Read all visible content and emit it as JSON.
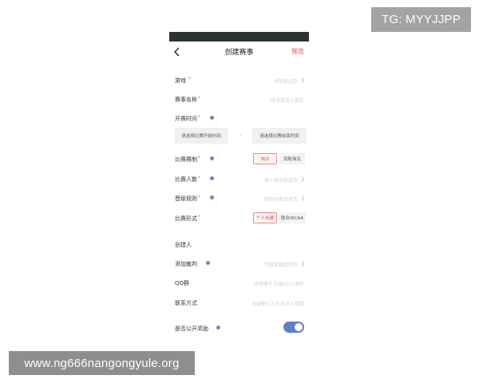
{
  "watermarks": {
    "top": "TG: MYYJJPP",
    "bottom": "www.ng666nangongyule.org"
  },
  "nav": {
    "title": "创建赛事",
    "preview_label": "预览"
  },
  "form": {
    "game": {
      "label": "游戏",
      "required": "*",
      "placeholder": "请选择游戏"
    },
    "name": {
      "label": "赛事名称",
      "required": "*",
      "placeholder": "请输入赛事名称"
    },
    "time": {
      "label": "开赛时间",
      "required": "*",
      "start_placeholder": "请选择比赛开始时间",
      "separator": "-",
      "end_placeholder": "请选择比赛结束时间"
    },
    "format": {
      "label": "比赛赛制",
      "required": "*",
      "options": [
        "淘汰",
        "双败淘汰"
      ],
      "selected": "淘汰"
    },
    "count": {
      "label": "比赛人数",
      "required": "*",
      "placeholder": "请选择比赛人数"
    },
    "advance": {
      "label": "晋级规则",
      "required": "*",
      "placeholder": "请选择晋级规则"
    },
    "mode": {
      "label": "比赛形式",
      "required": "*",
      "options": [
        "个人创建",
        "联合WCAA"
      ],
      "selected": "个人创建"
    },
    "creator": {
      "label": "创建人"
    },
    "referee": {
      "label": "添加裁判",
      "placeholder": "请添加赛事裁判"
    },
    "qq": {
      "label": "QQ群",
      "placeholder": "请输入QQ群号方便联系"
    },
    "contact": {
      "label": "联系方式",
      "placeholder": "请输入联系方式方便联系"
    },
    "public_reward": {
      "label": "是否公开奖励",
      "enabled": true
    }
  },
  "colors": {
    "accent_red": "#e0504f",
    "toggle_blue": "#5e7fcb",
    "info_blue": "#6f88c0",
    "status_bar": "#2b3431"
  }
}
